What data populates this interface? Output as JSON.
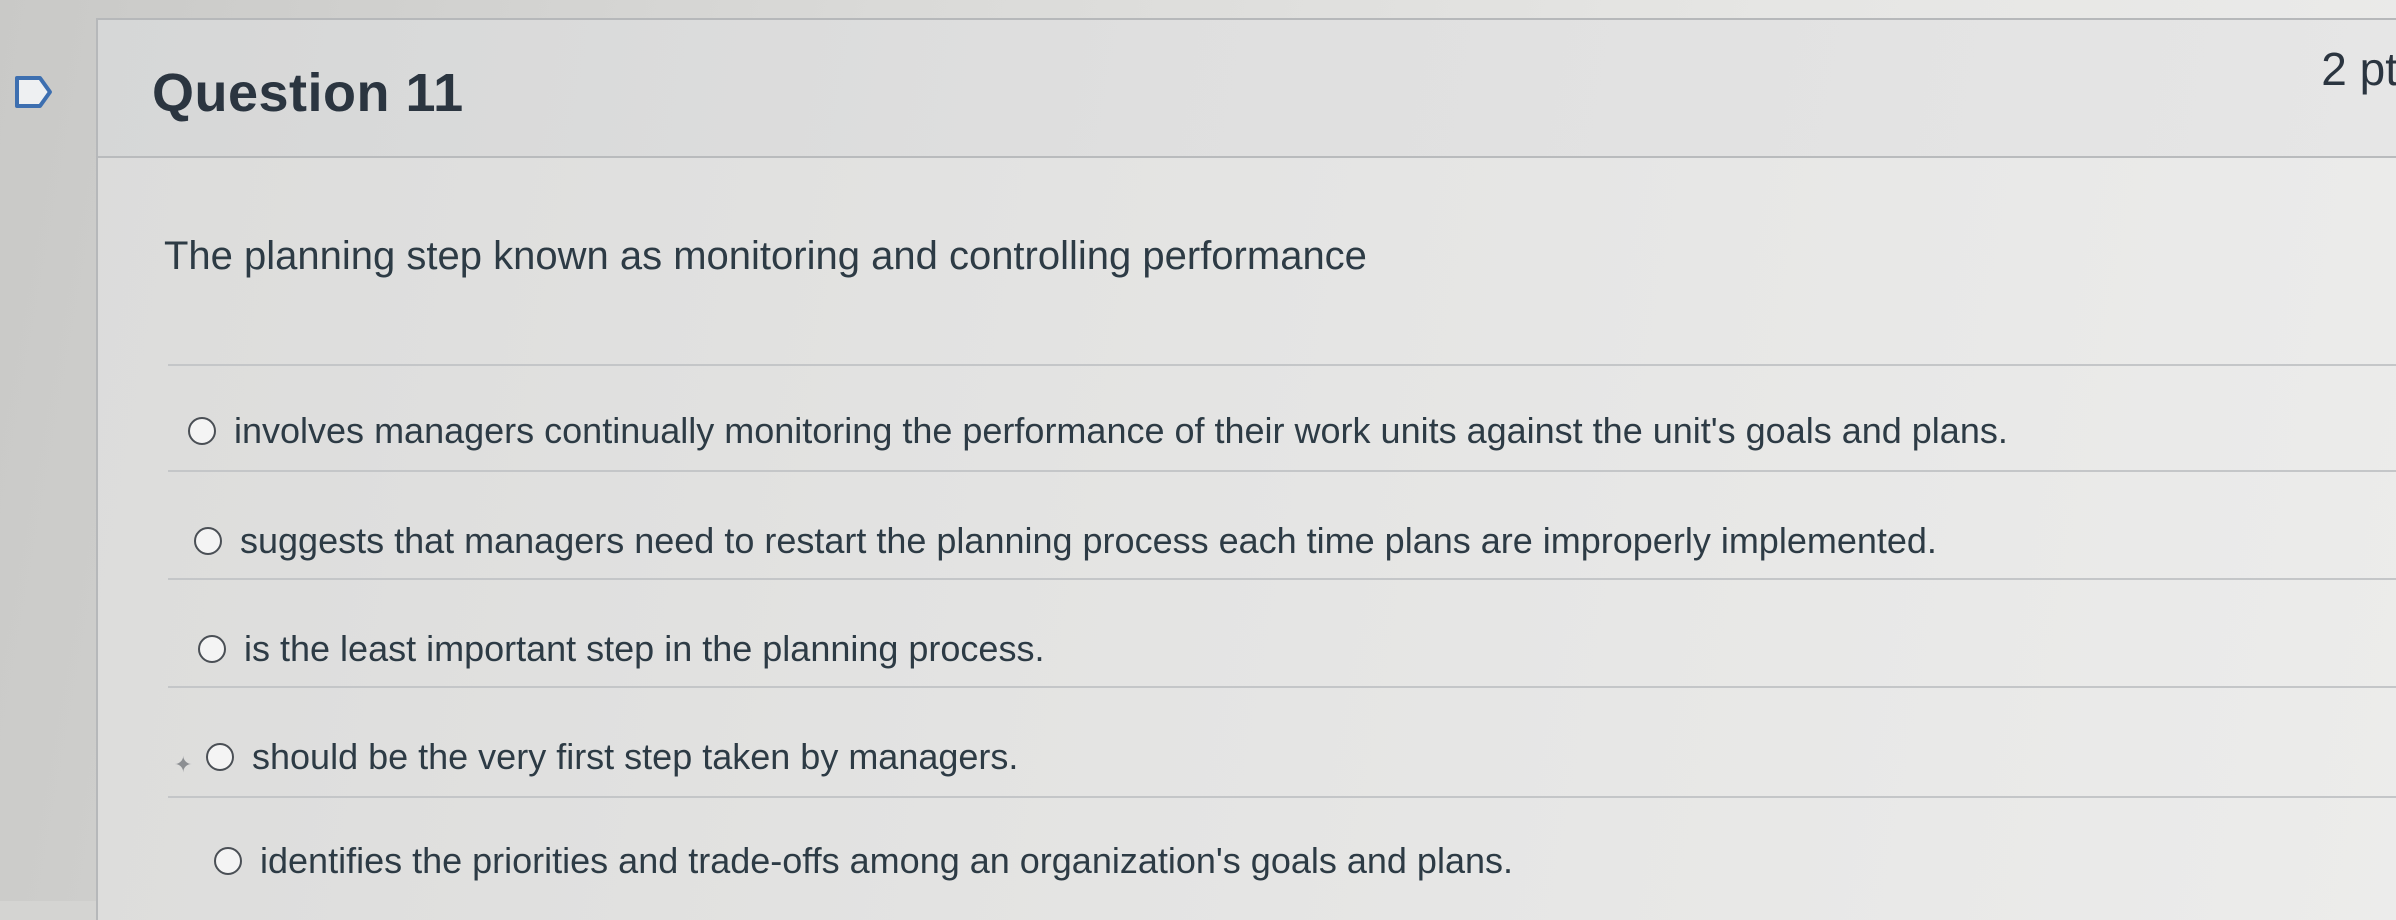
{
  "question": {
    "title": "Question 11",
    "points": "2 pt",
    "flag_icon": "bookmark-flag-icon",
    "prompt": "The planning step known as monitoring and controlling performance"
  },
  "answers": [
    {
      "label": "involves managers continually monitoring the performance of their work units against the unit's goals and plans."
    },
    {
      "label": "suggests that managers need to restart the planning process each time plans are improperly implemented."
    },
    {
      "label": "is the least important step in the planning process."
    },
    {
      "label": "should be the very first step taken by managers."
    },
    {
      "label": "identifies the priorities and trade-offs among an organization's goals and plans."
    }
  ]
}
